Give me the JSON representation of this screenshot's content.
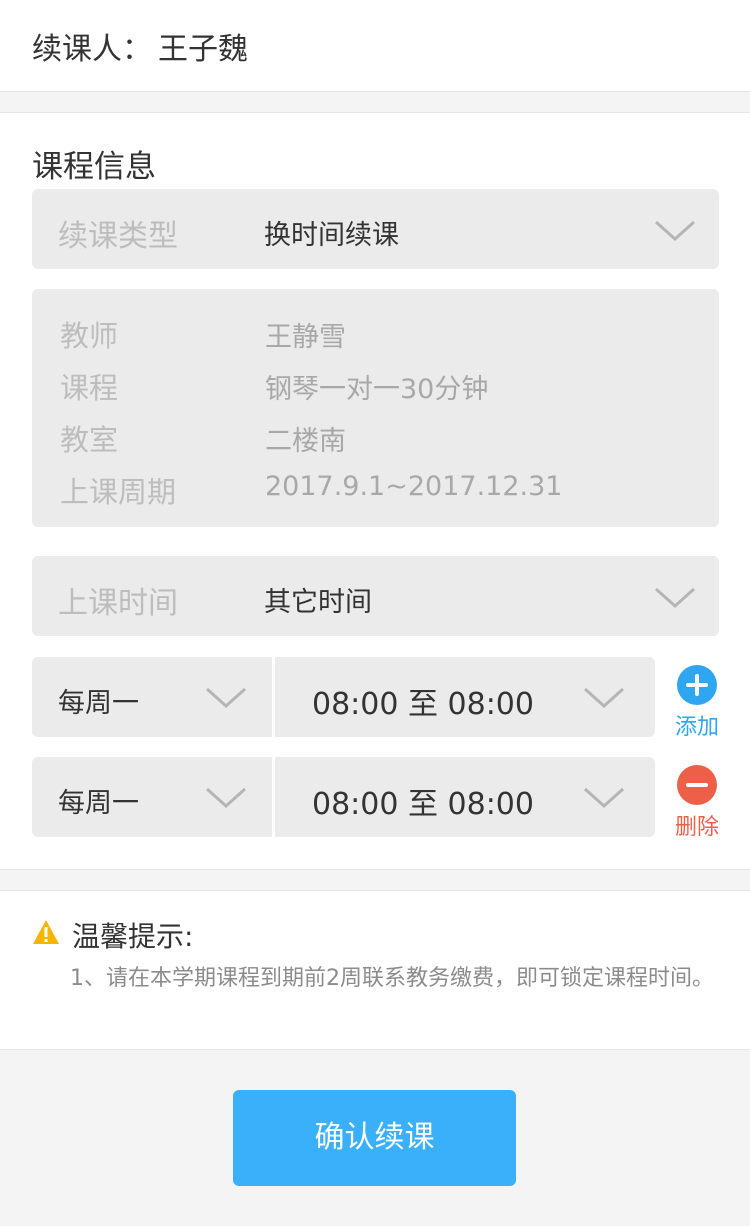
{
  "renewer": {
    "label": "续课人：",
    "name": "王子魏"
  },
  "course": {
    "section_title": "课程信息",
    "renew_type": {
      "label": "续课类型",
      "value": "换时间续课"
    },
    "info": [
      {
        "label": "教师",
        "value": "王静雪"
      },
      {
        "label": "课程",
        "value": "钢琴一对一30分钟"
      },
      {
        "label": "教室",
        "value": "二楼南"
      },
      {
        "label": "上课周期",
        "value": "2017.9.1~2017.12.31"
      }
    ],
    "class_time": {
      "label": "上课时间",
      "value": "其它时间"
    },
    "schedule": [
      {
        "day": "每周一",
        "range": "08:00 至 08:00",
        "action": "添加"
      },
      {
        "day": "每周一",
        "range": "08:00 至 08:00",
        "action": "删除"
      }
    ]
  },
  "tip": {
    "title": "温馨提示:",
    "body": "1、请在本学期课程到期前2周联系教务缴费，即可锁定课程时间。"
  },
  "confirm_label": "确认续课",
  "colors": {
    "accent": "#3ab0fb",
    "add": "#2fa6f1",
    "delete": "#ee5f48",
    "warning": "#f7b500"
  }
}
